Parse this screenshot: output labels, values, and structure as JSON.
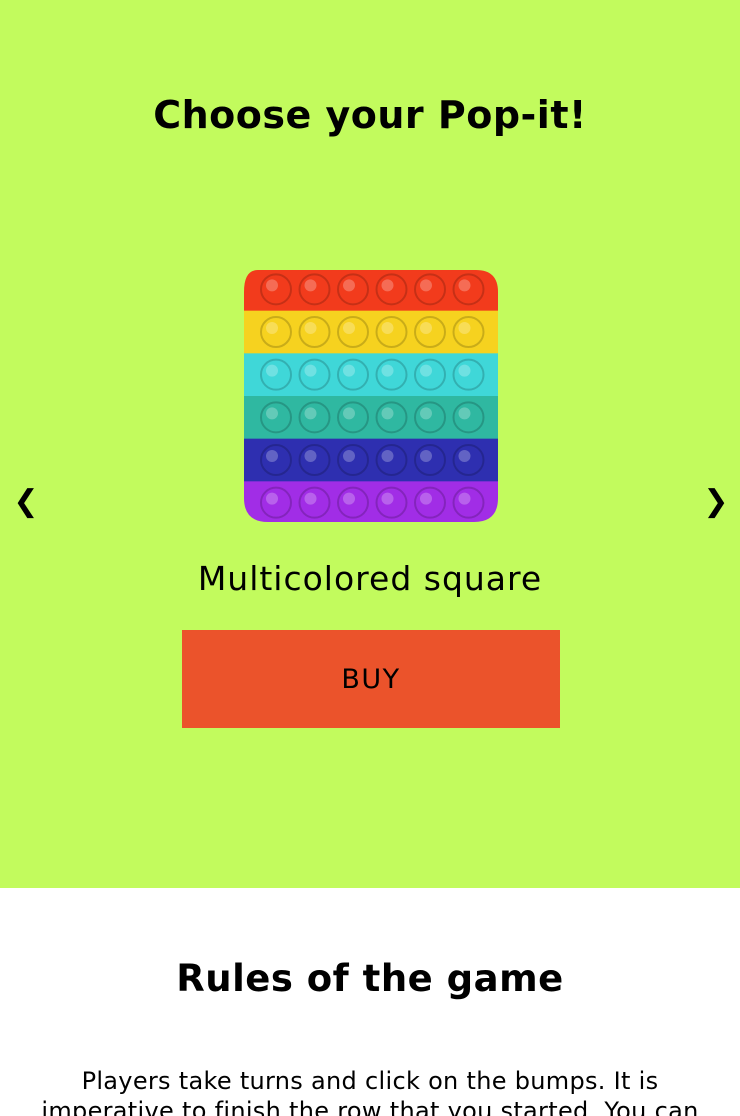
{
  "hero": {
    "title": "Choose your Pop-it!",
    "prev_arrow": "❮",
    "next_arrow": "❯"
  },
  "product": {
    "name": "Multicolored square",
    "buy_label": "BUY",
    "image_icon": "rainbow-square-pop-it",
    "colors": [
      "#f23b1c",
      "#f6d21f",
      "#3fd7d8",
      "#2fb8a1",
      "#2e2fb0",
      "#a12de6"
    ]
  },
  "rules": {
    "title": "Rules of the game",
    "text": "Players take turns and click on the bumps. It is imperative to finish the row that you started. You can"
  },
  "colors": {
    "hero_background": "#c2fb5d",
    "buy_button": "#eb532b",
    "rules_background": "#ffffff"
  }
}
